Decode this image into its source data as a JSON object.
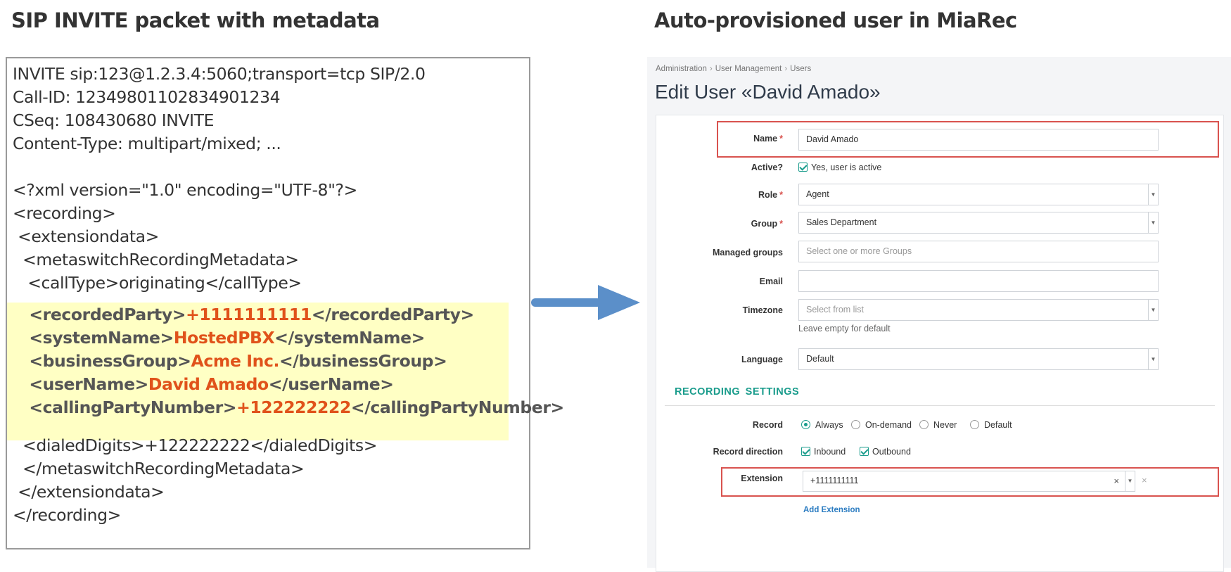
{
  "headings": {
    "left": "SIP INVITE packet with metadata",
    "right": "Auto-provisioned user in MiaRec"
  },
  "packet": {
    "lines": [
      "INVITE sip:123@1.2.3.4:5060;transport=tcp SIP/2.0",
      "Call-ID: 12349801102834901234",
      "CSeq: 108430680 INVITE",
      "Content-Type: multipart/mixed; ...",
      "",
      "<?xml version=\"1.0\" encoding=\"UTF-8\"?>",
      "<recording>",
      " <extensiondata>",
      "  <metaswitchRecordingMetadata>",
      "   <callType>originating</callType>"
    ],
    "highlighted": [
      {
        "open": "   <recordedParty>",
        "value": "+1111111111",
        "close": "</recordedParty>"
      },
      {
        "open": "   <systemName>",
        "value": "HostedPBX",
        "close": "</systemName>"
      },
      {
        "open": "   <businessGroup>",
        "value": "Acme Inc.",
        "close": "</businessGroup>"
      },
      {
        "open": "   <userName>",
        "value": "David Amado",
        "close": "</userName>"
      },
      {
        "open": "   <callingPartyNumber>",
        "value": "+122222222",
        "close": "</callingPartyNumber>"
      }
    ],
    "tail": [
      "  <dialedDigits>+122222222</dialedDigits>",
      "  </metaswitchRecordingMetadata>",
      " </extensiondata>",
      "</recording>"
    ]
  },
  "colors": {
    "highlight_bg": "#ffffc4",
    "value_orange": "#e0521a",
    "arrow": "#5b8fc9",
    "accent_teal": "#1a9c8c",
    "required_red": "#d9534f",
    "link_blue": "#2b7cc1"
  },
  "ui": {
    "breadcrumbs": [
      "Administration",
      "User Management",
      "Users"
    ],
    "title": "Edit User «David Amado»",
    "form": {
      "name": {
        "label": "Name",
        "value": "David Amado"
      },
      "active": {
        "label": "Active?",
        "option": "Yes, user is active"
      },
      "role": {
        "label": "Role",
        "value": "Agent"
      },
      "group": {
        "label": "Group",
        "value": "Sales Department"
      },
      "managed_groups": {
        "label": "Managed groups",
        "placeholder": "Select one or more Groups"
      },
      "email": {
        "label": "Email",
        "value": ""
      },
      "timezone": {
        "label": "Timezone",
        "placeholder": "Select from list",
        "help": "Leave empty for default"
      },
      "language": {
        "label": "Language",
        "value": "Default"
      }
    },
    "recording": {
      "section_title": "RECORDING SETTINGS",
      "record": {
        "label": "Record",
        "options": [
          "Always",
          "On-demand",
          "Never",
          "Default"
        ],
        "selected": "Always"
      },
      "direction": {
        "label": "Record direction",
        "options": [
          "Inbound",
          "Outbound"
        ]
      },
      "extension": {
        "label": "Extension",
        "value": "+1111111111",
        "add_label": "Add Extension"
      }
    }
  }
}
